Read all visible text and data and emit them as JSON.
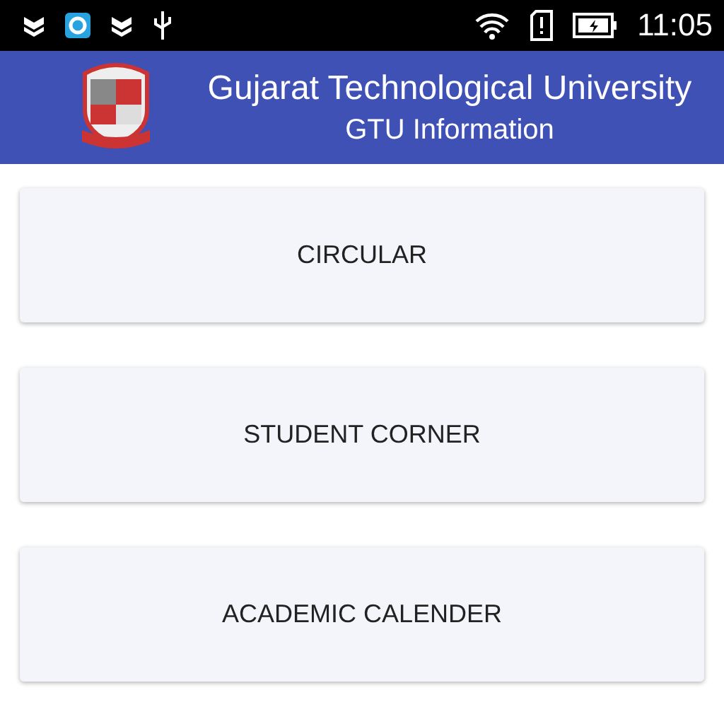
{
  "status_bar": {
    "time": "11:05"
  },
  "app_bar": {
    "title": "Gujarat Technological University",
    "subtitle": "GTU Information"
  },
  "buttons": [
    {
      "label": "CIRCULAR"
    },
    {
      "label": "STUDENT CORNER"
    },
    {
      "label": "ACADEMIC CALENDER"
    }
  ]
}
